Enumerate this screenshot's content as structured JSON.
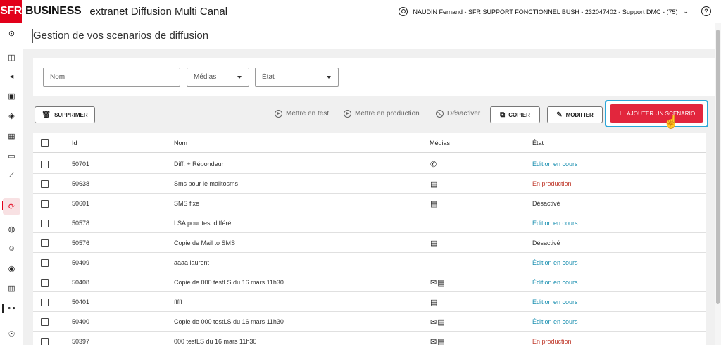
{
  "header": {
    "logo_sfr": "SFR",
    "logo_business": "BUSINESS",
    "app_title": "extranet Diffusion Multi Canal",
    "user": "NAUDIN Fernand - SFR SUPPORT FONCTIONNEL BUSH - 232047402 - Support DMC - (75)",
    "user_chevron": "⌄",
    "help": "?"
  },
  "page": {
    "title": "Gestion de vos scenarios de diffusion"
  },
  "filters": {
    "name_placeholder": "Nom",
    "medias_label": "Médias",
    "etat_label": "État"
  },
  "toolbar": {
    "delete": "SUPPRIMER",
    "test": "Mettre en test",
    "production": "Mettre en production",
    "deactivate": "Désactiver",
    "copy": "COPIER",
    "modify": "MODIFIER",
    "add": "AJOUTER UN SCENARIO"
  },
  "table": {
    "headers": {
      "id": "Id",
      "nom": "Nom",
      "medias": "Médias",
      "etat": "État"
    },
    "rows": [
      {
        "id": "50701",
        "nom": "Diff. + Répondeur",
        "medias": "✆",
        "etat": "Édition en cours",
        "status": "en"
      },
      {
        "id": "50638",
        "nom": "Sms pour le mailtosms",
        "medias": "▤",
        "etat": "En production",
        "status": "prod"
      },
      {
        "id": "50601",
        "nom": "SMS fixe",
        "medias": "▤",
        "etat": "Désactivé",
        "status": "des"
      },
      {
        "id": "50578",
        "nom": "LSA pour test différé",
        "medias": "",
        "etat": "Édition en cours",
        "status": "en"
      },
      {
        "id": "50576",
        "nom": "Copie de Mail to SMS",
        "medias": "▤",
        "etat": "Désactivé",
        "status": "des"
      },
      {
        "id": "50409",
        "nom": "aaaa laurent",
        "medias": "",
        "etat": "Édition en cours",
        "status": "en"
      },
      {
        "id": "50408",
        "nom": "Copie de 000 testLS du 16 mars 11h30",
        "medias": "✉▤",
        "etat": "Édition en cours",
        "status": "en"
      },
      {
        "id": "50401",
        "nom": "fffff",
        "medias": "▤",
        "etat": "Édition en cours",
        "status": "en"
      },
      {
        "id": "50400",
        "nom": "Copie de 000 testLS du 16 mars 11h30",
        "medias": "✉▤",
        "etat": "Édition en cours",
        "status": "en"
      },
      {
        "id": "50397",
        "nom": "000 testLS du 16 mars 11h30",
        "medias": "✉▤",
        "etat": "En production",
        "status": "prod"
      }
    ]
  },
  "colors": {
    "brand": "#e2001a",
    "accent": "#e2263d",
    "status_edit": "#1a8fb0",
    "status_prod": "#c0392b",
    "focus": "#2aa6d8"
  }
}
